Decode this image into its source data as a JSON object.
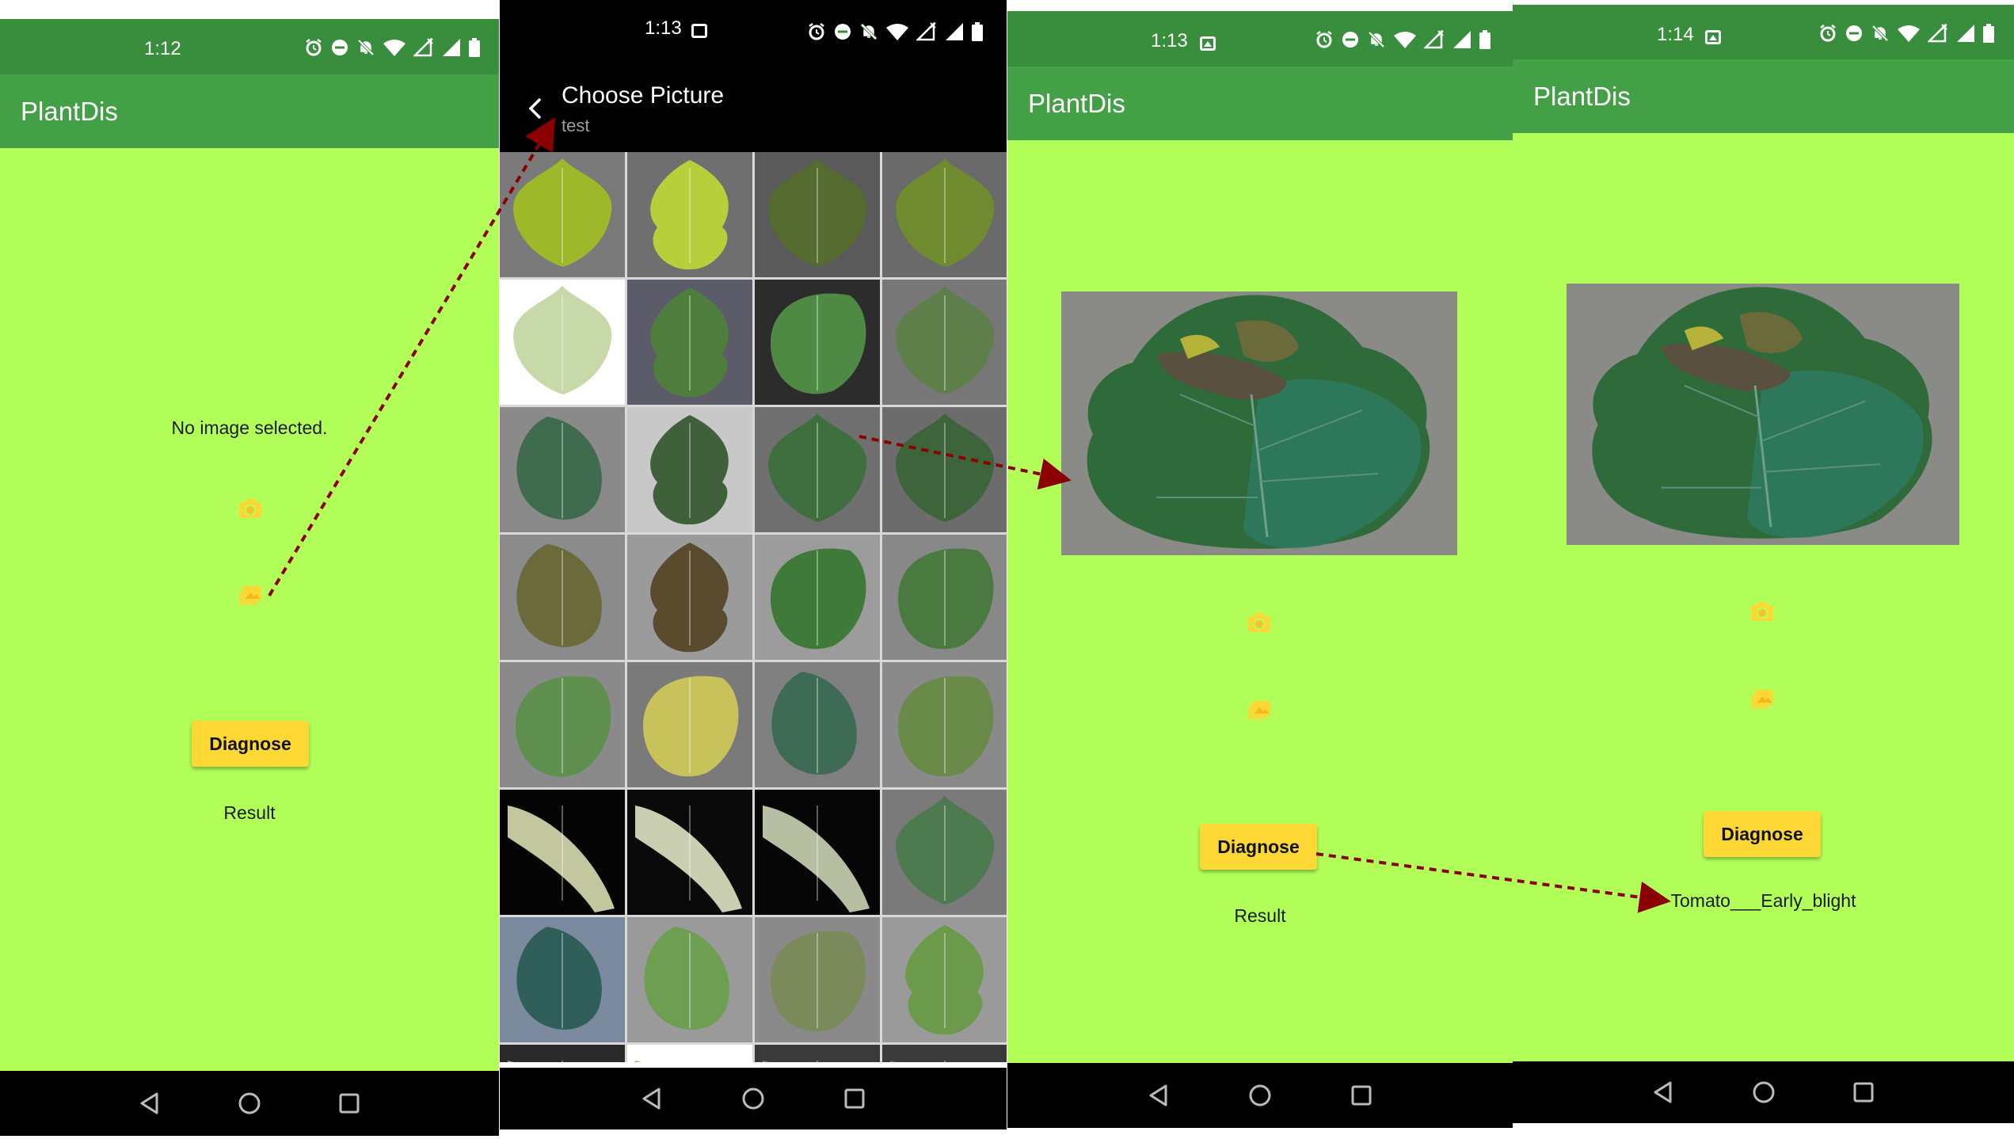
{
  "screens": [
    {
      "status_time": "1:12",
      "app_title": "PlantDis",
      "message": "No image selected.",
      "diagnose_label": "Diagnose",
      "result_text": "Result"
    },
    {
      "status_time": "1:13",
      "picker_title": "Choose Picture",
      "picker_subtitle": "test"
    },
    {
      "status_time": "1:13",
      "app_title": "PlantDis",
      "diagnose_label": "Diagnose",
      "result_text": "Result"
    },
    {
      "status_time": "1:14",
      "app_title": "PlantDis",
      "diagnose_label": "Diagnose",
      "result_text": "Tomato___Early_blight"
    }
  ],
  "icons": {
    "status": [
      "alarm-icon",
      "dnd-icon",
      "bell-off-icon",
      "wifi-icon",
      "signal-x-icon",
      "signal-icon",
      "battery-icon"
    ],
    "nav": [
      "back-nav-icon",
      "home-nav-icon",
      "recents-nav-icon"
    ],
    "actions": [
      "camera-icon",
      "gallery-icon"
    ]
  },
  "colors": {
    "status_bar": "#388e3c",
    "app_bar": "#43a047",
    "background": "#b2ff59",
    "button": "#fdd835",
    "icon": "#fdd835",
    "arrow": "#8b0000"
  }
}
